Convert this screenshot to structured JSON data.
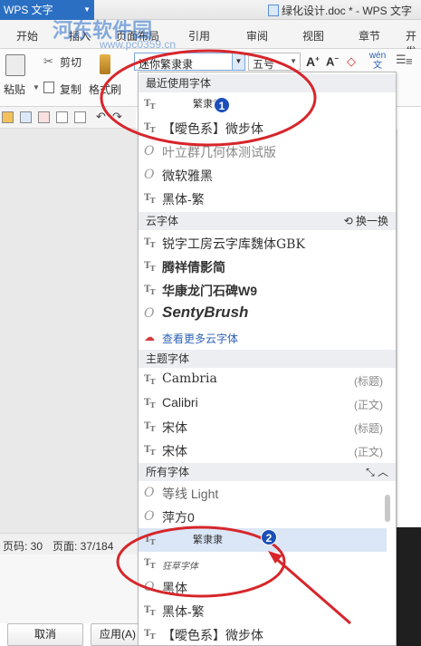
{
  "titlebar": {
    "app_name": "WPS 文字",
    "document_title": "绿化设计.doc * - WPS 文字"
  },
  "ribbon": {
    "tabs": [
      "开始",
      "插入",
      "页面布局",
      "引用",
      "审阅",
      "视图",
      "章节",
      "开发"
    ],
    "paste_label": "粘贴",
    "cut_label": "剪切",
    "copy_label": "复制",
    "format_painter_label": "格式刷",
    "font_name_value": "迷你繁隶隶",
    "font_size_value": "五号"
  },
  "watermark": {
    "site": "河东软件园",
    "url": "www.pc0359.cn"
  },
  "font_panel": {
    "recent": {
      "header": "最近使用字体",
      "items": [
        {
          "name": "繁隶隶",
          "icon": "tt"
        },
        {
          "name": "【曖色系】微步体",
          "icon": "tt"
        },
        {
          "name": "叶立群几何体测试版",
          "icon": "o"
        },
        {
          "name": "微软雅黑",
          "icon": "o"
        },
        {
          "name": "黑体-繁",
          "icon": "tt"
        }
      ]
    },
    "cloud": {
      "header": "云字体",
      "action": "换一换",
      "items": [
        {
          "name": "锐字工房云字库魏体GBK",
          "icon": "tt"
        },
        {
          "name": "腾祥倩影简",
          "icon": "tt"
        },
        {
          "name": "华康龙门石碑W9",
          "icon": "tt"
        },
        {
          "name": "SentyBrush",
          "icon": "o"
        }
      ],
      "more_link": "查看更多云字体"
    },
    "theme": {
      "header": "主题字体",
      "items": [
        {
          "name": "Cambria",
          "tag": "(标题)"
        },
        {
          "name": "Calibri",
          "tag": "(正文)"
        },
        {
          "name": "宋体",
          "tag": "(标题)"
        },
        {
          "name": "宋体",
          "tag": "(正文)"
        }
      ]
    },
    "all": {
      "header": "所有字体",
      "items": [
        {
          "name": "等线 Light",
          "icon": "o"
        },
        {
          "name": "萍方0",
          "icon": "o"
        },
        {
          "name": "繁隶隶",
          "icon": "tt",
          "selected": true
        },
        {
          "name": "狂草字体",
          "icon": "tt"
        },
        {
          "name": "黑体",
          "icon": "o"
        },
        {
          "name": "黑体-繁",
          "icon": "tt"
        },
        {
          "name": "【曖色系】微步体",
          "icon": "tt"
        }
      ]
    }
  },
  "statusbar": {
    "line_label": "页码: 30",
    "page_label": "页面: 37/184"
  },
  "dialog_buttons": {
    "cancel": "取消",
    "apply": "应用(A)"
  },
  "annotations": {
    "badge_1": "1",
    "badge_2": "2",
    "accent": "#d6262b"
  }
}
